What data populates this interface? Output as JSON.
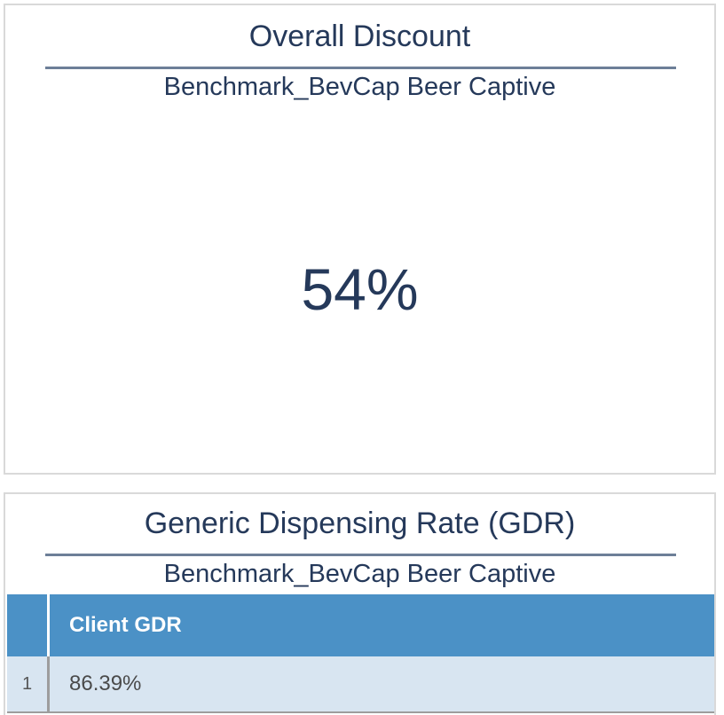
{
  "discount_panel": {
    "title": "Overall Discount",
    "subtitle": "Benchmark_BevCap Beer Captive",
    "value": "54%"
  },
  "gdr_panel": {
    "title": "Generic Dispensing Rate (GDR)",
    "subtitle": "Benchmark_BevCap Beer Captive",
    "table": {
      "columns": [
        "",
        "Client GDR"
      ],
      "rows": [
        {
          "index": "1",
          "client_gdr": "86.39%"
        }
      ]
    }
  },
  "colors": {
    "title_text": "#25395a",
    "rule": "#6d7f98",
    "table_header_bg": "#4b91c6",
    "table_row_bg": "#d8e5f1",
    "panel_border": "#d9d9d9"
  }
}
